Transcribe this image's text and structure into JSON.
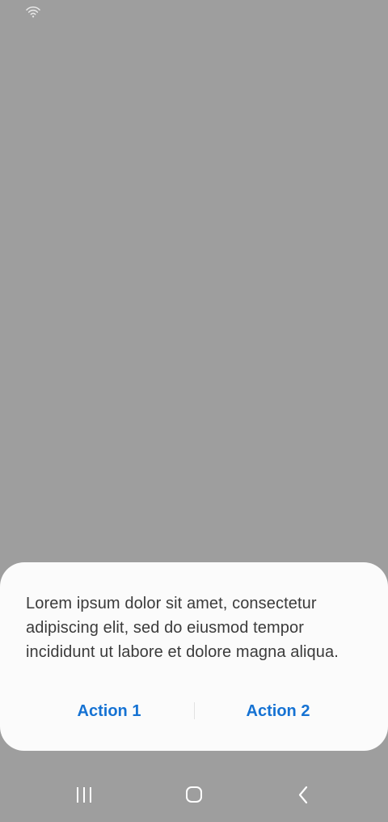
{
  "status_bar": {
    "wifi_icon": "wifi-icon"
  },
  "dialog": {
    "message": "Lorem ipsum dolor sit amet, consectetur adipiscing elit, sed do eiusmod tempor incididunt ut labore et dolore magna aliqua.",
    "actions": [
      {
        "label": "Action 1"
      },
      {
        "label": "Action 2"
      }
    ]
  },
  "nav_bar": {
    "recents_icon": "recents-icon",
    "home_icon": "home-icon",
    "back_icon": "back-icon"
  },
  "colors": {
    "scrim": "#9e9e9e",
    "sheet": "#fbfbfb",
    "accent": "#1572d3",
    "text": "#3b3b3b"
  }
}
